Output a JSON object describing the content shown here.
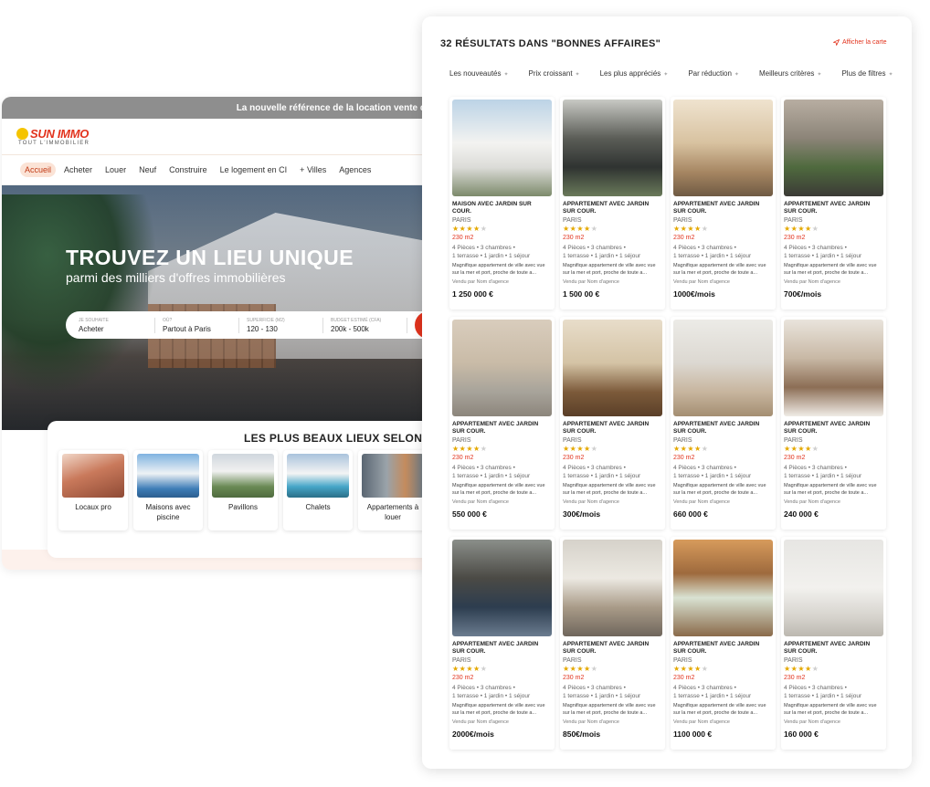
{
  "homepage": {
    "promo_text": "La nouvelle référence de la location vente d",
    "logo": {
      "word": "SUN IMMO",
      "subline": "TOUT L'IMMOBILIER"
    },
    "nav": [
      "Accueil",
      "Acheter",
      "Louer",
      "Neuf",
      "Construire",
      "Le logement en CI",
      "Villes",
      "Agences"
    ],
    "nav_plus_symbol": "+",
    "hero": {
      "title": "TROUVEZ UN LIEU UNIQUE",
      "subtitle": "parmi des milliers d'offres immobilières"
    },
    "search": {
      "fields": [
        {
          "label": "JE SOUHAITE",
          "value": "Acheter"
        },
        {
          "label": "OÙ?",
          "value": "Partout à Paris"
        },
        {
          "label": "SUPERFICIE (M2)",
          "value": "120 - 130"
        },
        {
          "label": "BUDGET ESTIMÉ (CFA)",
          "value": "200k - 500k"
        }
      ],
      "button_icon": "search-icon"
    },
    "section_title": "LES PLUS BEAUX LIEUX SELON V",
    "categories": [
      {
        "label": "Locaux pro"
      },
      {
        "label": "Maisons avec piscine"
      },
      {
        "label": "Pavillons"
      },
      {
        "label": "Chalets"
      },
      {
        "label": "Appartements à louer"
      }
    ]
  },
  "results": {
    "title": "32 RÉSULTATS DANS \"BONNES AFFAIRES\"",
    "map_link": "Afficher la carte",
    "filters": [
      "Les nouveautés",
      "Prix croissant",
      "Les plus appréciés",
      "Par réduction",
      "Meilleurs critères",
      "Plus de filtres"
    ],
    "listing_defaults": {
      "city": "PARIS",
      "area": "230 m2",
      "rooms": "4 Pièces • 3 chambres •",
      "amenities": "1 terrasse • 1 jardin • 1 séjour",
      "description": "Magnifique appartement de ville avec vue sur la mer et port, proche de toute a...",
      "agency": "Vendu par Nom d'agence"
    },
    "listings": [
      {
        "title": "MAISON AVEC JARDIN SUR COUR.",
        "price": "1 250 000 €",
        "rating": 4
      },
      {
        "title": "APPARTEMENT AVEC JARDIN SUR COUR.",
        "price": "1 500 00 €",
        "rating": 4
      },
      {
        "title": "APPARTEMENT AVEC JARDIN SUR COUR.",
        "price": "1000€/mois",
        "rating": 4
      },
      {
        "title": "APPARTEMENT AVEC JARDIN SUR COUR.",
        "price": "700€/mois",
        "rating": 4
      },
      {
        "title": "APPARTEMENT AVEC JARDIN SUR COUR.",
        "price": "550 000 €",
        "rating": 4
      },
      {
        "title": "APPARTEMENT AVEC JARDIN SUR COUR.",
        "price": "300€/mois",
        "rating": 4
      },
      {
        "title": "APPARTEMENT AVEC JARDIN SUR COUR.",
        "price": "660 000 €",
        "rating": 4
      },
      {
        "title": "APPARTEMENT AVEC JARDIN SUR COUR.",
        "price": "240 000 €",
        "rating": 4
      },
      {
        "title": "APPARTEMENT AVEC JARDIN SUR COUR.",
        "price": "2000€/mois",
        "rating": 4
      },
      {
        "title": "APPARTEMENT AVEC JARDIN SUR COUR.",
        "price": "850€/mois",
        "rating": 4
      },
      {
        "title": "APPARTEMENT AVEC JARDIN SUR COUR.",
        "price": "1100 000 €",
        "rating": 4
      },
      {
        "title": "APPARTEMENT AVEC JARDIN SUR COUR.",
        "price": "160 000 €",
        "rating": 4
      }
    ]
  },
  "colors": {
    "accent": "#e2331d",
    "star": "#e4a800",
    "logo_sun": "#f5c400"
  }
}
